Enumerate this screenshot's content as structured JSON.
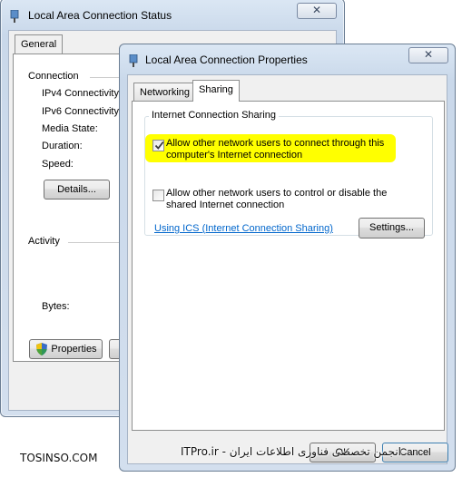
{
  "status_window": {
    "title": "Local Area Connection Status",
    "close_glyph": "✕",
    "tabs": [
      {
        "label": "General"
      }
    ],
    "connection": {
      "group_label": "Connection",
      "rows": [
        {
          "label": "IPv4 Connectivity"
        },
        {
          "label": "IPv6 Connectivity"
        },
        {
          "label": "Media State:"
        },
        {
          "label": "Duration:"
        },
        {
          "label": "Speed:"
        }
      ],
      "details_button": "Details..."
    },
    "activity": {
      "group_label": "Activity",
      "bytes_label": "Bytes:"
    },
    "properties_button": "Properties"
  },
  "properties_window": {
    "title": "Local Area Connection Properties",
    "close_glyph": "✕",
    "tabs": [
      {
        "label": "Networking",
        "active": false
      },
      {
        "label": "Sharing",
        "active": true
      }
    ],
    "ics_group": {
      "label": "Internet Connection Sharing",
      "option_allow_connect": {
        "checked": true,
        "line1": "Allow other network users to connect through this",
        "line2": "computer's Internet connection"
      },
      "option_allow_control": {
        "checked": false,
        "line1": "Allow other network users to control or disable the",
        "line2": "shared Internet connection"
      },
      "help_link": "Using ICS (Internet Connection Sharing)",
      "settings_button": "Settings..."
    },
    "ok_button": "OK",
    "cancel_button": "Cancel"
  },
  "watermark": {
    "left": "TOSINSO.COM",
    "right": "انجمن تخصصی فناوری اطلاعات ایران - ITPro.ir"
  },
  "colors": {
    "highlight": "#ffff00",
    "link": "#0066cc",
    "window_frame": "#c9d8ea"
  }
}
